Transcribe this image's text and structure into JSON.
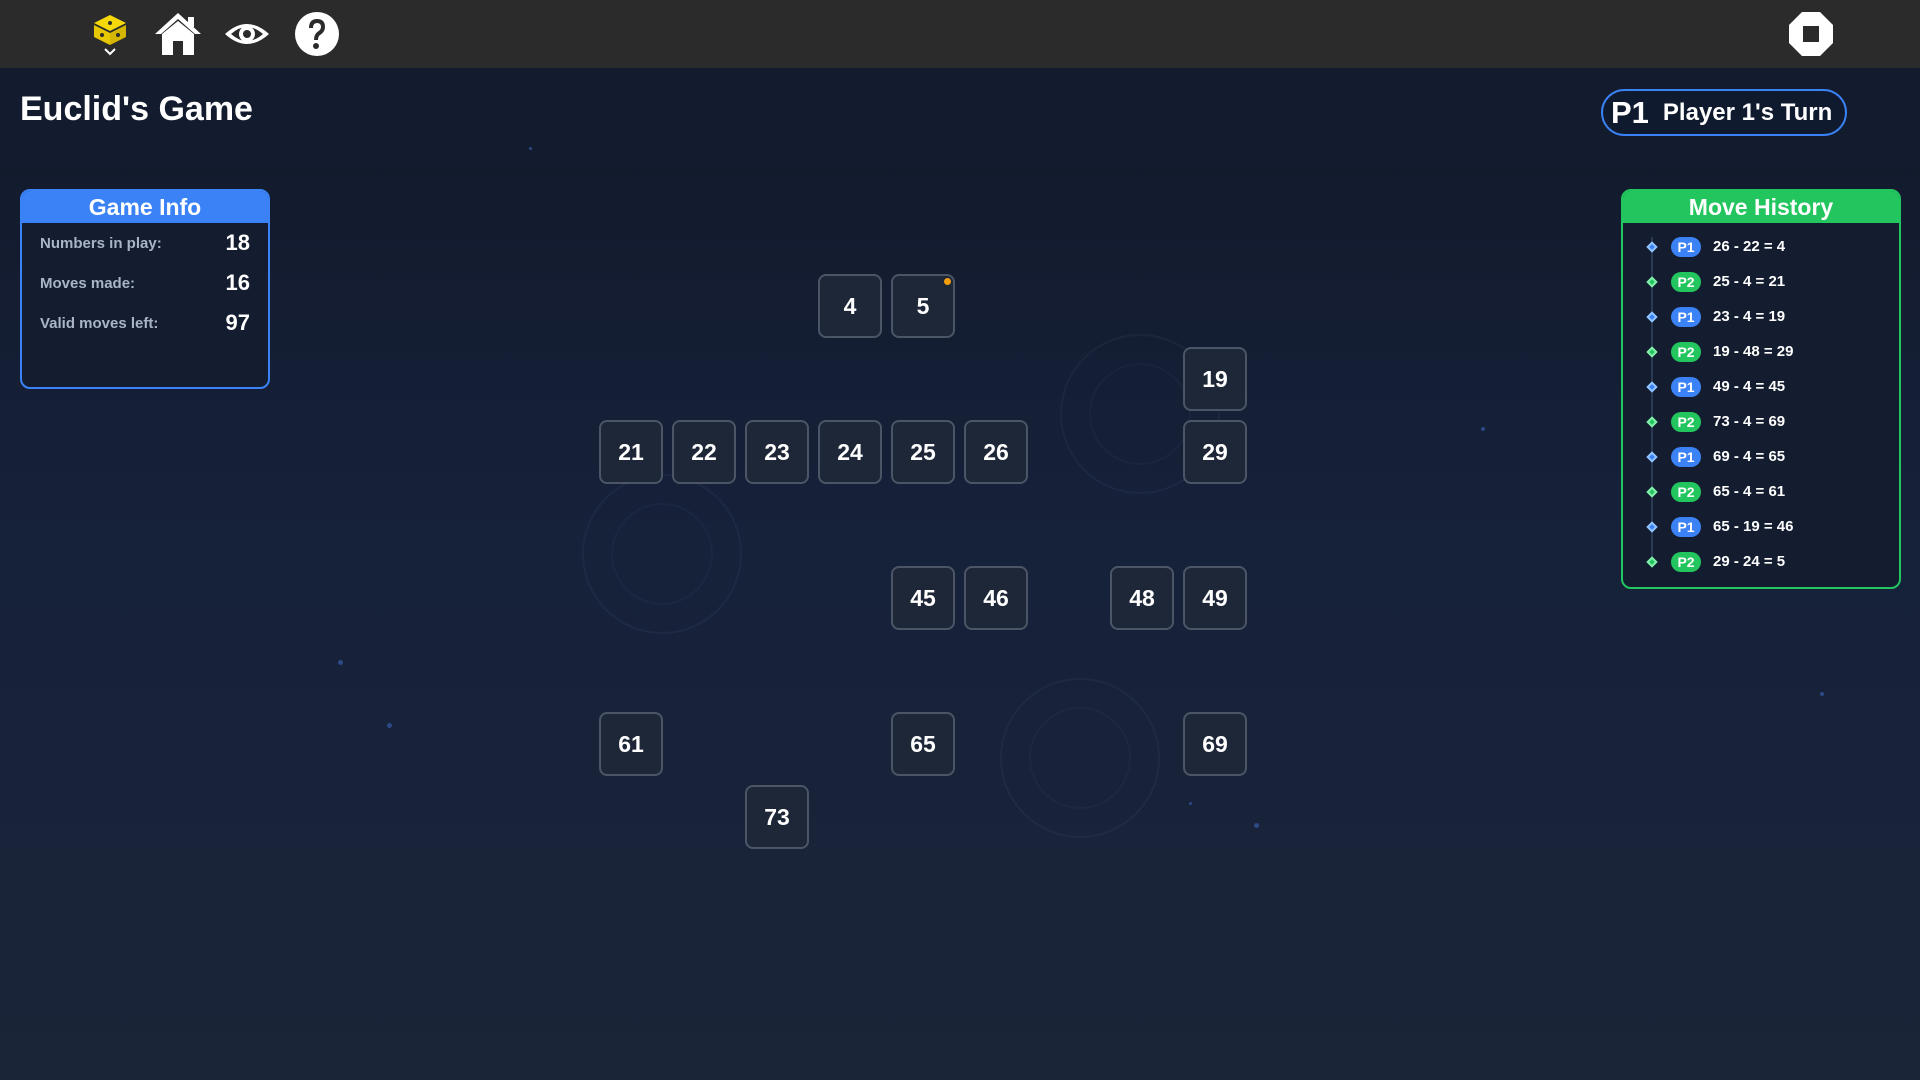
{
  "app": {
    "title": "Euclid's Game",
    "accent_p1": "#3b82f6",
    "accent_p2": "#22c55e"
  },
  "toolbar": {
    "icons": [
      "app-logo-icon",
      "home-icon",
      "eye-icon",
      "help-icon",
      "stop-icon"
    ]
  },
  "turn": {
    "tag": "P1",
    "label": "Player 1's Turn"
  },
  "info": {
    "title": "Game Info",
    "rows": [
      {
        "label": "Numbers in play:",
        "value": "18"
      },
      {
        "label": "Moves made:",
        "value": "16"
      },
      {
        "label": "Valid moves left:",
        "value": "97"
      }
    ]
  },
  "history": {
    "title": "Move History",
    "items": [
      {
        "player": "P1",
        "text": "26 - 22 = 4"
      },
      {
        "player": "P2",
        "text": "25 - 4 = 21"
      },
      {
        "player": "P1",
        "text": "23 - 4 = 19"
      },
      {
        "player": "P2",
        "text": "19 - 48 = 29"
      },
      {
        "player": "P1",
        "text": "49 - 4 = 45"
      },
      {
        "player": "P2",
        "text": "73 - 4 = 69"
      },
      {
        "player": "P1",
        "text": "69 - 4 = 65"
      },
      {
        "player": "P2",
        "text": "65 - 4 = 61"
      },
      {
        "player": "P1",
        "text": "65 - 19 = 46"
      },
      {
        "player": "P2",
        "text": "29 - 24 = 5"
      }
    ]
  },
  "board": {
    "tiles": [
      "4",
      "5",
      "19",
      "21",
      "22",
      "23",
      "24",
      "25",
      "26",
      "29",
      "45",
      "46",
      "48",
      "49",
      "61",
      "65",
      "69",
      "73"
    ],
    "marked_tile": "5"
  }
}
